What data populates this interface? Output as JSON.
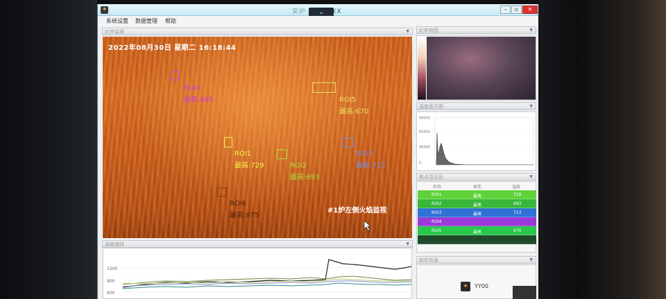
{
  "window": {
    "title": "XXX",
    "collapse_symbol": "⌄",
    "app_icon": "flame-logo-icon"
  },
  "menu": [
    "系统设置",
    "数据管理",
    "帮助"
  ],
  "panels": {
    "video_title": "红外监视",
    "thermal_title": "红外热图",
    "histogram_title": "温度直方图",
    "roi_table_title": "焦点显示区",
    "trend_title": "温度曲线",
    "bottom_title": "软件信息"
  },
  "video": {
    "timestamp": "2022年08月30日  星期二  16:18:44",
    "caption": "#1炉左侧火焰监视",
    "rois": [
      {
        "name": "ROI4",
        "reading": "最高:899",
        "color": "#d23ad8"
      },
      {
        "name": "ROI5",
        "reading": "最高:670",
        "color": "#e8e060"
      },
      {
        "name": "ROI1",
        "reading": "最高:729",
        "color": "#f2f24a"
      },
      {
        "name": "ROI2",
        "reading": "最高:693",
        "color": "#a8e23a"
      },
      {
        "name": "ROI3",
        "reading": "最高:713",
        "color": "#6f8fe8"
      },
      {
        "name": "ROI6",
        "reading": "最高:875",
        "color": "#7a3b18"
      }
    ]
  },
  "histogram": {
    "ticks": [
      "90000",
      "60000",
      "30000",
      "0"
    ]
  },
  "roi_table": {
    "headers": [
      "名称",
      "类型",
      "温度"
    ],
    "rows": [
      {
        "name": "ROI1",
        "type": "最高",
        "temp": "729",
        "color": "#5fd23a"
      },
      {
        "name": "ROI2",
        "type": "最高",
        "temp": "693",
        "color": "#38b83a"
      },
      {
        "name": "ROI3",
        "type": "最高",
        "temp": "713",
        "color": "#2f72d6"
      },
      {
        "name": "ROI4",
        "type": "",
        "temp": "",
        "color": "#9b3ad8"
      },
      {
        "name": "ROI5",
        "type": "最高",
        "temp": "670",
        "color": "#28c84a"
      },
      {
        "name": "",
        "type": "",
        "temp": "",
        "color": "#1f4a2c"
      }
    ]
  },
  "trend": {
    "y_ticks": [
      "1200",
      "900",
      "600"
    ]
  },
  "brand": {
    "label": "YY00"
  }
}
